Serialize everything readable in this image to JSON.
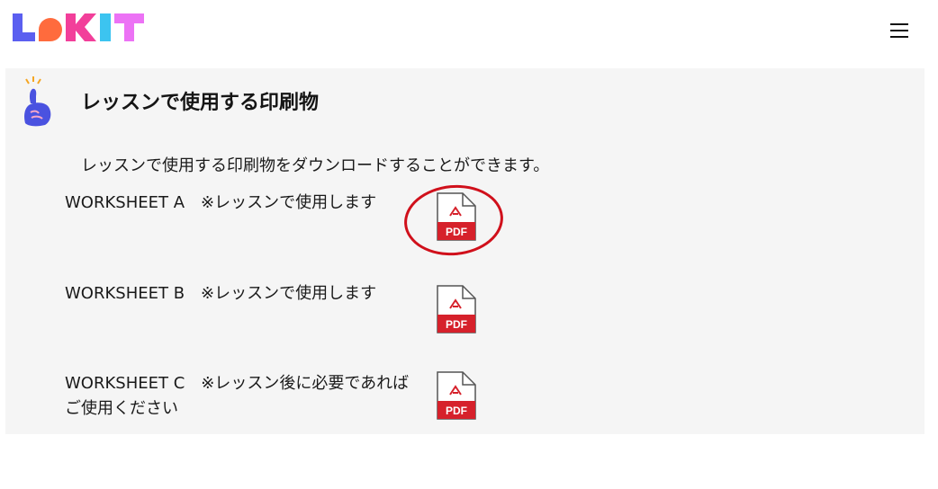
{
  "header": {
    "logo_text": "LeKIT",
    "logo_colors": [
      "#5b5ff0",
      "#ff6b3d",
      "#f23f9a",
      "#3cc4f0",
      "#ec72f5"
    ],
    "menu_icon": "hamburger-menu-icon"
  },
  "section": {
    "icon": "hand-pointing-icon",
    "title": "レッスンで使用する印刷物",
    "description": "レッスンで使用する印刷物をダウンロードすることができます。"
  },
  "worksheets": [
    {
      "label": "WORKSHEET A　※レッスンで使用します",
      "icon": "pdf-icon",
      "file_badge": "PDF"
    },
    {
      "label": "WORKSHEET B　※レッスンで使用します",
      "icon": "pdf-icon",
      "file_badge": "PDF"
    },
    {
      "label": "WORKSHEET C　※レッスン後に必要であればご使用ください",
      "icon": "pdf-icon",
      "file_badge": "PDF"
    }
  ],
  "annotation": {
    "color": "#d0101b",
    "target": "WORKSHEET A pdf-icon"
  },
  "colors": {
    "panel_bg": "#f5f5f5",
    "pdf_red": "#d6212b",
    "hand_blue": "#4a52e0"
  }
}
